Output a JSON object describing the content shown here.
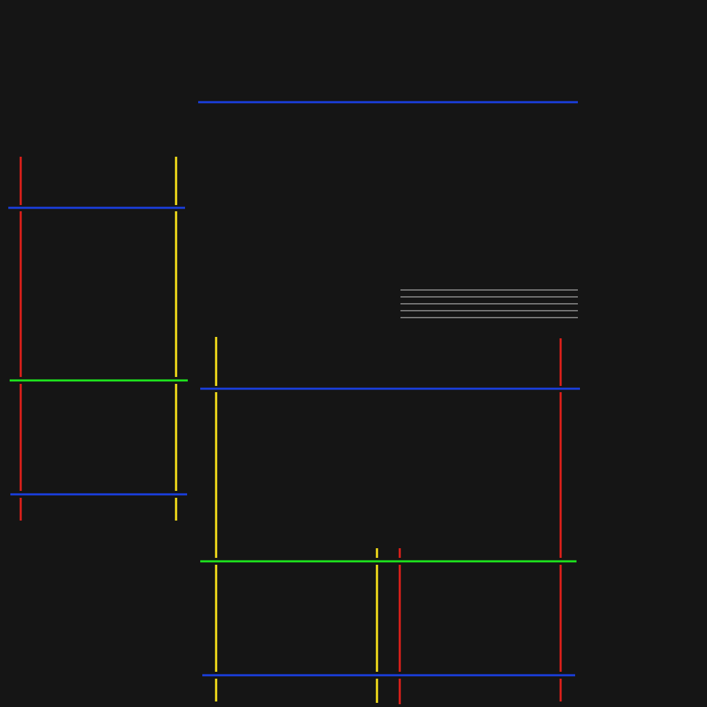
{
  "colors": {
    "background": "#151515",
    "red": "#e0201a",
    "yellow": "#ffe71a",
    "blue": "#1a3fe0",
    "green": "#1ee61e",
    "white": "#dcdcdc"
  },
  "diagram": {
    "top_line": {
      "color": "blue"
    },
    "left_group": {
      "horizontal_lines": [
        "blue",
        "green",
        "blue"
      ],
      "vertical_lines": [
        "red",
        "yellow"
      ]
    },
    "right_group": {
      "horizontal_lines": [
        "blue",
        "green",
        "blue"
      ],
      "vertical_lines": [
        "yellow",
        "red"
      ],
      "inner_vertical_lines": [
        "yellow",
        "red"
      ]
    },
    "hatch": {
      "color": "white",
      "line_count": 5
    }
  }
}
